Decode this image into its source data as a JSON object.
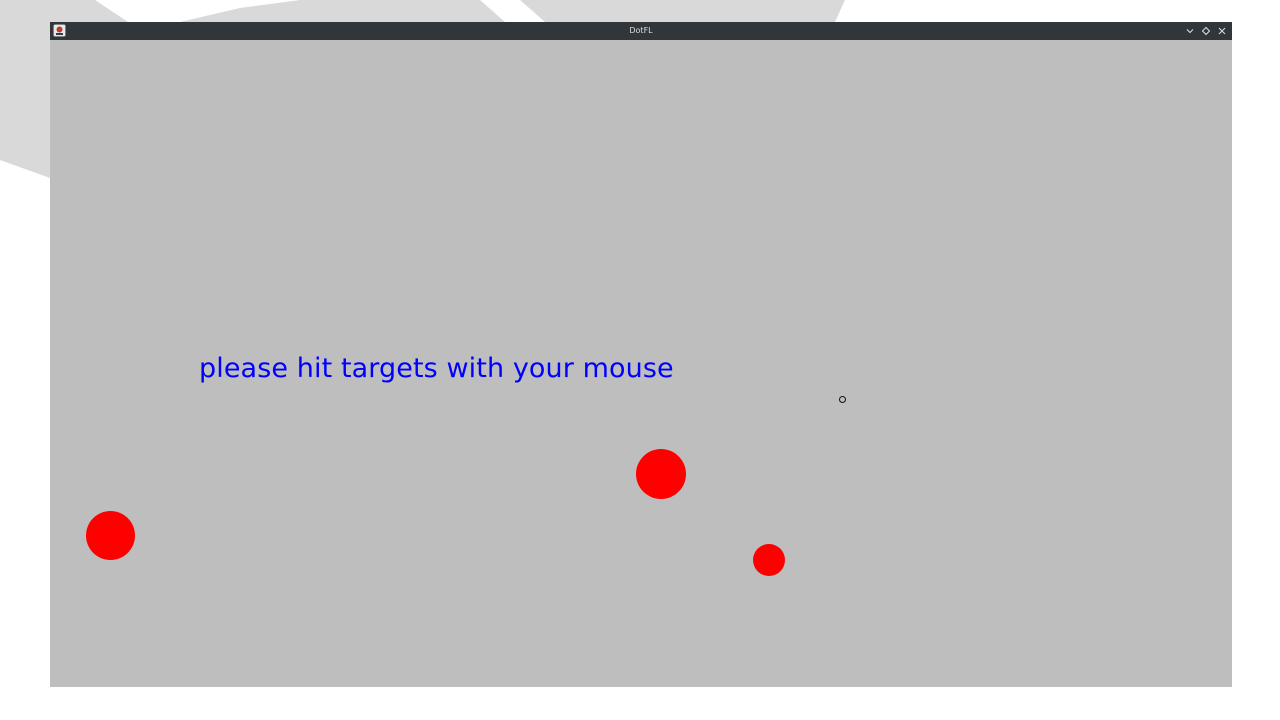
{
  "window": {
    "title": "DotFL",
    "icon": "java-app-icon",
    "controls": [
      {
        "name": "minimize-button",
        "icon": "chevron-down-icon"
      },
      {
        "name": "maximize-button",
        "icon": "diamond-icon"
      },
      {
        "name": "close-button",
        "icon": "close-icon"
      }
    ]
  },
  "game": {
    "instruction": "please hit targets with your mouse",
    "instruction_color": "#0000ff",
    "background_color": "#bebebe",
    "target_color": "#ff0000",
    "target_count": 3
  }
}
